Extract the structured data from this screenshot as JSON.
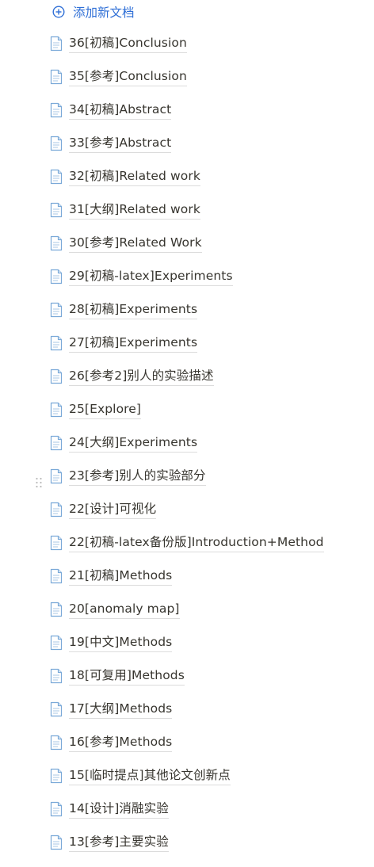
{
  "add_doc": {
    "label": "添加新文档"
  },
  "icons": {
    "add": "plus-circle-icon",
    "document": "document-icon",
    "drag": "drag-handle-icon"
  },
  "colors": {
    "accent": "#2f6fd6",
    "text": "#37352f",
    "underline": "#dcdcdc"
  },
  "documents": [
    {
      "title": "36[初稿]Conclusion"
    },
    {
      "title": "35[参考]Conclusion"
    },
    {
      "title": "34[初稿]Abstract"
    },
    {
      "title": "33[参考]Abstract"
    },
    {
      "title": "32[初稿]Related work"
    },
    {
      "title": "31[大纲]Related work"
    },
    {
      "title": "30[参考]Related Work"
    },
    {
      "title": "29[初稿-latex]Experiments"
    },
    {
      "title": "28[初稿]Experiments"
    },
    {
      "title": "27[初稿]Experiments"
    },
    {
      "title": "26[参考2]别人的实验描述"
    },
    {
      "title": "25[Explore]"
    },
    {
      "title": "24[大纲]Experiments"
    },
    {
      "title": "23[参考]别人的实验部分"
    },
    {
      "title": "22[设计]可视化"
    },
    {
      "title": "22[初稿-latex备份版]Introduction+Method"
    },
    {
      "title": "21[初稿]Methods"
    },
    {
      "title": "20[anomaly map]"
    },
    {
      "title": "19[中文]Methods"
    },
    {
      "title": "18[可复用]Methods"
    },
    {
      "title": "17[大纲]Methods"
    },
    {
      "title": "16[参考]Methods"
    },
    {
      "title": "15[临时提点]其他论文创新点"
    },
    {
      "title": "14[设计]消融实验"
    },
    {
      "title": "13[参考]主要实验"
    }
  ]
}
